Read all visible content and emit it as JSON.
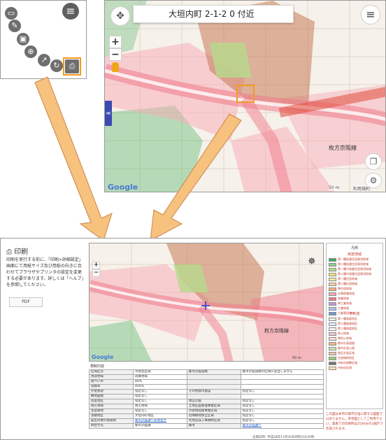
{
  "panelA": {
    "menu_icon": "hamburger-icon",
    "tools": [
      {
        "icon": "ruler-icon",
        "glyph": "▭"
      },
      {
        "icon": "pencil-icon",
        "glyph": "✎"
      },
      {
        "icon": "image-icon",
        "glyph": "▣"
      },
      {
        "icon": "globe-icon",
        "glyph": "⊕"
      },
      {
        "icon": "route-icon",
        "glyph": "↗"
      },
      {
        "icon": "reload-icon",
        "glyph": "↻"
      },
      {
        "icon": "printer-icon",
        "glyph": "⎙"
      }
    ],
    "selected_tool": "printer-icon",
    "highlight_color": "#f59a1e"
  },
  "panelB": {
    "address": "大垣内町 2-1-2 0 付近",
    "zoom_in": "+",
    "zoom_out": "−",
    "map_brand": "Google",
    "scale_label": "50 m",
    "terms": "利用規約",
    "place_label": "枚方京阪線",
    "side_tab": "≪",
    "layers_icon": "layers-icon",
    "settings_icon": "gear-icon",
    "compass_icon": "compass-icon",
    "pegman_icon": "pegman-icon"
  },
  "panelC": {
    "title": "印刷",
    "instructions": "印刷を実行する前に、「印刷>詳細設定」画面にて用紙サイズ及び用紙の向きに合わせてブラウザやプリンタの設定を変更する必要があります。詳しくは「ヘルプ」を参照してください。",
    "pdf_label": "PDF",
    "map_brand": "Google",
    "scale_label": "50 m",
    "place_label": "枚方京阪線",
    "legend": {
      "title": "凡例",
      "section1": "用途地域",
      "items1": [
        {
          "label": "第一種低層住居専用地域",
          "color": "#3fae5a"
        },
        {
          "label": "第二種低層住居専用地域",
          "color": "#8ad28c"
        },
        {
          "label": "第一種中高層住居専用地域",
          "color": "#b6e08c"
        },
        {
          "label": "第二種中高層住居専用地域",
          "color": "#f3e17a"
        },
        {
          "label": "第一種住居地域",
          "color": "#fbe7a2"
        },
        {
          "label": "第二種住居地域",
          "color": "#fbcfa0"
        },
        {
          "label": "準住居地域",
          "color": "#f7b27a"
        },
        {
          "label": "近隣商業地域",
          "color": "#f7a9b5"
        },
        {
          "label": "商業地域",
          "color": "#f07c8c"
        },
        {
          "label": "準工業地域",
          "color": "#c49adb"
        },
        {
          "label": "工業地域",
          "color": "#a7c8ec"
        },
        {
          "label": "工業専用地域",
          "color": "#6b9bd6"
        }
      ],
      "section2": "その他",
      "items2": [
        {
          "label": "第一種高度地区",
          "color": "#e6f4e6"
        },
        {
          "label": "第二種高度地区",
          "color": "#ddeefa"
        },
        {
          "label": "第三種高度地区",
          "color": "#f6f6f6"
        },
        {
          "label": "防火地域",
          "color": "#f2c6c6"
        },
        {
          "label": "準防火地域",
          "color": "#fbe0e0"
        },
        {
          "label": "都市計画道路",
          "color": "#f2b98c"
        },
        {
          "label": "都市計画公園",
          "color": "#c9e6b0"
        },
        {
          "label": "地区計画区域",
          "color": "#e8c8a8"
        },
        {
          "label": "生産緑地地区",
          "color": "#9bcf7a"
        },
        {
          "label": "市街化調整区域",
          "color": "#777777"
        },
        {
          "label": "市街化区域",
          "color": "#fbe5b0"
        }
      ]
    },
    "table": {
      "caption": "規制内容",
      "rows": [
        [
          "区域区分",
          "市街化区域",
          "都市計画道路",
          "都市計画道路の区域に該当しません"
        ],
        [
          "用途地域",
          "商業地域",
          "",
          ""
        ],
        [
          "建ぺい率",
          "80%",
          "",
          ""
        ],
        [
          "容積率",
          "400%",
          "",
          ""
        ],
        [
          "外壁後退",
          "指定なし",
          "その他都市施設",
          "指定なし"
        ],
        [
          "敷地面積",
          "指定なし",
          "",
          ""
        ],
        [
          "高度地区",
          "指定なし",
          "地区計画",
          "指定なし"
        ],
        [
          "防火地域",
          "防火地域",
          "土地区画整理事業区域",
          "指定なし"
        ],
        [
          "生産緑地",
          "指定なし",
          "市街地開発事業区域",
          "指定なし"
        ],
        [
          "景観地区",
          "大垣内町地区",
          "近隣緑地保全区域",
          "指定なし"
        ],
        [
          "届出対象の建築物",
          "都市計画課へお問合せ",
          "宅地造成工事規制区域",
          "指定なし"
        ],
        [
          "問合せ先",
          "都市計画課",
          "備考",
          "都市計画課へ"
        ]
      ]
    },
    "note": "この図は本市の都市計画に関する図面ではありません。参考図としてご利用下さい。業者での印刷時は2500分の1縮尺で作成されます。",
    "footer": "出典日時: 平成28年11月30日9時52分30秒"
  }
}
